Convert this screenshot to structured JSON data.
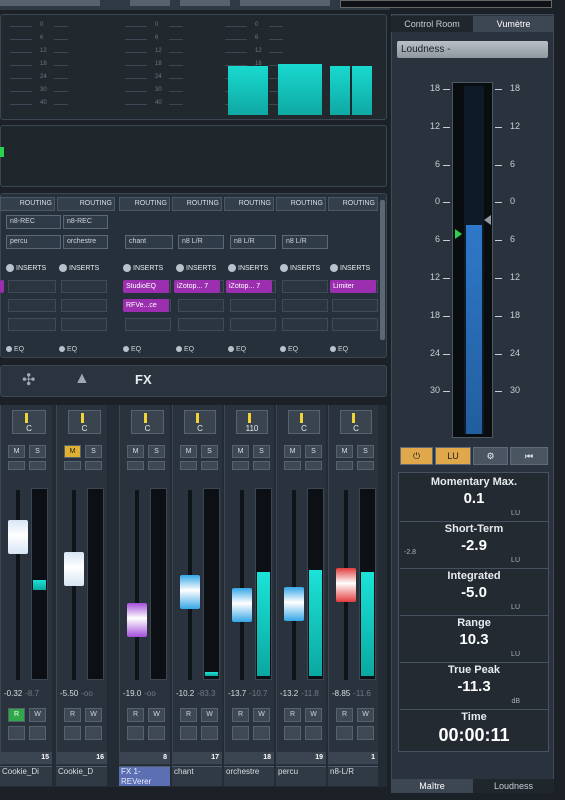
{
  "side_tabs": {
    "control_room": "Control Room",
    "vumetre": "Vumètre",
    "maitre": "Maître",
    "loudness": "Loudness"
  },
  "loudness_dropdown": "Loudness -",
  "scale_labels": [
    "18",
    "12",
    "6",
    "0",
    "6",
    "12",
    "18",
    "24",
    "30"
  ],
  "meter_scale_labels": [
    "0",
    "6",
    "12",
    "18",
    "24",
    "30",
    "40"
  ],
  "routing_label": "ROUTING",
  "routing": [
    {
      "in": "n8-REC",
      "out": "percu"
    },
    {
      "in": "n8-REC",
      "out": "orchestre"
    },
    {
      "in": "",
      "out": "chant"
    },
    {
      "in": "",
      "out": "n8 L/R"
    },
    {
      "in": "",
      "out": "n8 L/R"
    },
    {
      "in": "",
      "out": "n8 L/R"
    }
  ],
  "inserts_label": "INSERTS",
  "inserts": [
    "StudioEQ",
    "iZotop... 7",
    "iZotop... 7",
    "Limiter",
    "RFVe...ce"
  ],
  "eq_label": "EQ",
  "fx_label": "FX",
  "pan_values": [
    "C",
    "C",
    "C",
    "C",
    "110",
    "C",
    "C"
  ],
  "m_label": "M",
  "s_label": "S",
  "r_label": "R",
  "w_label": "W",
  "volumes": [
    {
      "vol": "-0.32",
      "peak": "-8.7"
    },
    {
      "vol": "-5.50",
      "peak": "-oo"
    },
    {
      "vol": "-19.0",
      "peak": "-oo"
    },
    {
      "vol": "-10.2",
      "peak": "-83.3"
    },
    {
      "vol": "-13.7",
      "peak": "-10.7"
    },
    {
      "vol": "-13.2",
      "peak": "-11.8"
    },
    {
      "vol": "-8.85",
      "peak": "-11.6"
    }
  ],
  "channel_numbers": [
    "15",
    "16",
    "8",
    "17",
    "18",
    "19",
    "1"
  ],
  "channel_names": [
    "Cookie_Di",
    "Cookie_D",
    "FX 1-REVerer",
    "chant",
    "orchestre",
    "percu",
    "n8-L/R"
  ],
  "buttons": {
    "power": "⏻",
    "lu": "LU",
    "gear": "⚙",
    "reset": "⏮"
  },
  "stats": [
    {
      "label": "Momentary Max.",
      "value": "0.1",
      "unit": "LU",
      "extra": ""
    },
    {
      "label": "Short-Term",
      "value": "-2.9",
      "unit": "LU",
      "extra": "-2.8"
    },
    {
      "label": "Integrated",
      "value": "-5.0",
      "unit": "LU",
      "extra": ""
    },
    {
      "label": "Range",
      "value": "10.3",
      "unit": "LU",
      "extra": ""
    },
    {
      "label": "True Peak",
      "value": "-11.3",
      "unit": "dB",
      "extra": ""
    },
    {
      "label": "Time",
      "value": "00:00:11",
      "unit": "",
      "extra": ""
    }
  ],
  "accent": "#1cc7c1",
  "insert_color": "#9b2fb0",
  "mute_color": "#e0b030"
}
